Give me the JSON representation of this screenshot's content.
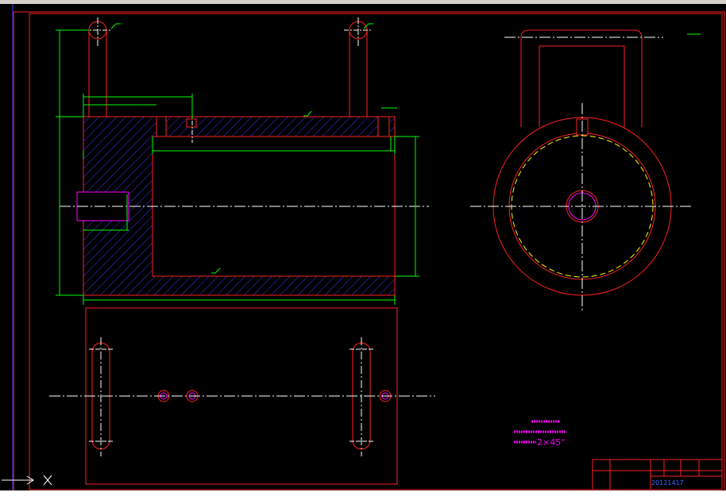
{
  "title_block": {
    "designed_value": "20121417"
  },
  "technical_requirements": {
    "item_2_value": "2×45°"
  },
  "colors": {
    "outline": "#ff2020",
    "dimension": "#00ff00",
    "centerline": "#ffffff",
    "hatch": "#3a3aff",
    "text_magenta": "#ff00ff",
    "hidden_yellow": "#ffff00"
  }
}
